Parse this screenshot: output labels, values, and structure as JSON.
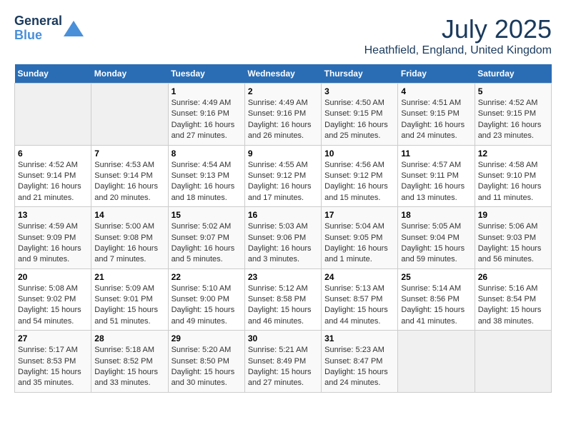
{
  "header": {
    "logo_line1": "General",
    "logo_line2": "Blue",
    "title": "July 2025",
    "subtitle": "Heathfield, England, United Kingdom"
  },
  "columns": [
    "Sunday",
    "Monday",
    "Tuesday",
    "Wednesday",
    "Thursday",
    "Friday",
    "Saturday"
  ],
  "weeks": [
    [
      {
        "day": "",
        "info": ""
      },
      {
        "day": "",
        "info": ""
      },
      {
        "day": "1",
        "info": "Sunrise: 4:49 AM\nSunset: 9:16 PM\nDaylight: 16 hours\nand 27 minutes."
      },
      {
        "day": "2",
        "info": "Sunrise: 4:49 AM\nSunset: 9:16 PM\nDaylight: 16 hours\nand 26 minutes."
      },
      {
        "day": "3",
        "info": "Sunrise: 4:50 AM\nSunset: 9:15 PM\nDaylight: 16 hours\nand 25 minutes."
      },
      {
        "day": "4",
        "info": "Sunrise: 4:51 AM\nSunset: 9:15 PM\nDaylight: 16 hours\nand 24 minutes."
      },
      {
        "day": "5",
        "info": "Sunrise: 4:52 AM\nSunset: 9:15 PM\nDaylight: 16 hours\nand 23 minutes."
      }
    ],
    [
      {
        "day": "6",
        "info": "Sunrise: 4:52 AM\nSunset: 9:14 PM\nDaylight: 16 hours\nand 21 minutes."
      },
      {
        "day": "7",
        "info": "Sunrise: 4:53 AM\nSunset: 9:14 PM\nDaylight: 16 hours\nand 20 minutes."
      },
      {
        "day": "8",
        "info": "Sunrise: 4:54 AM\nSunset: 9:13 PM\nDaylight: 16 hours\nand 18 minutes."
      },
      {
        "day": "9",
        "info": "Sunrise: 4:55 AM\nSunset: 9:12 PM\nDaylight: 16 hours\nand 17 minutes."
      },
      {
        "day": "10",
        "info": "Sunrise: 4:56 AM\nSunset: 9:12 PM\nDaylight: 16 hours\nand 15 minutes."
      },
      {
        "day": "11",
        "info": "Sunrise: 4:57 AM\nSunset: 9:11 PM\nDaylight: 16 hours\nand 13 minutes."
      },
      {
        "day": "12",
        "info": "Sunrise: 4:58 AM\nSunset: 9:10 PM\nDaylight: 16 hours\nand 11 minutes."
      }
    ],
    [
      {
        "day": "13",
        "info": "Sunrise: 4:59 AM\nSunset: 9:09 PM\nDaylight: 16 hours\nand 9 minutes."
      },
      {
        "day": "14",
        "info": "Sunrise: 5:00 AM\nSunset: 9:08 PM\nDaylight: 16 hours\nand 7 minutes."
      },
      {
        "day": "15",
        "info": "Sunrise: 5:02 AM\nSunset: 9:07 PM\nDaylight: 16 hours\nand 5 minutes."
      },
      {
        "day": "16",
        "info": "Sunrise: 5:03 AM\nSunset: 9:06 PM\nDaylight: 16 hours\nand 3 minutes."
      },
      {
        "day": "17",
        "info": "Sunrise: 5:04 AM\nSunset: 9:05 PM\nDaylight: 16 hours\nand 1 minute."
      },
      {
        "day": "18",
        "info": "Sunrise: 5:05 AM\nSunset: 9:04 PM\nDaylight: 15 hours\nand 59 minutes."
      },
      {
        "day": "19",
        "info": "Sunrise: 5:06 AM\nSunset: 9:03 PM\nDaylight: 15 hours\nand 56 minutes."
      }
    ],
    [
      {
        "day": "20",
        "info": "Sunrise: 5:08 AM\nSunset: 9:02 PM\nDaylight: 15 hours\nand 54 minutes."
      },
      {
        "day": "21",
        "info": "Sunrise: 5:09 AM\nSunset: 9:01 PM\nDaylight: 15 hours\nand 51 minutes."
      },
      {
        "day": "22",
        "info": "Sunrise: 5:10 AM\nSunset: 9:00 PM\nDaylight: 15 hours\nand 49 minutes."
      },
      {
        "day": "23",
        "info": "Sunrise: 5:12 AM\nSunset: 8:58 PM\nDaylight: 15 hours\nand 46 minutes."
      },
      {
        "day": "24",
        "info": "Sunrise: 5:13 AM\nSunset: 8:57 PM\nDaylight: 15 hours\nand 44 minutes."
      },
      {
        "day": "25",
        "info": "Sunrise: 5:14 AM\nSunset: 8:56 PM\nDaylight: 15 hours\nand 41 minutes."
      },
      {
        "day": "26",
        "info": "Sunrise: 5:16 AM\nSunset: 8:54 PM\nDaylight: 15 hours\nand 38 minutes."
      }
    ],
    [
      {
        "day": "27",
        "info": "Sunrise: 5:17 AM\nSunset: 8:53 PM\nDaylight: 15 hours\nand 35 minutes."
      },
      {
        "day": "28",
        "info": "Sunrise: 5:18 AM\nSunset: 8:52 PM\nDaylight: 15 hours\nand 33 minutes."
      },
      {
        "day": "29",
        "info": "Sunrise: 5:20 AM\nSunset: 8:50 PM\nDaylight: 15 hours\nand 30 minutes."
      },
      {
        "day": "30",
        "info": "Sunrise: 5:21 AM\nSunset: 8:49 PM\nDaylight: 15 hours\nand 27 minutes."
      },
      {
        "day": "31",
        "info": "Sunrise: 5:23 AM\nSunset: 8:47 PM\nDaylight: 15 hours\nand 24 minutes."
      },
      {
        "day": "",
        "info": ""
      },
      {
        "day": "",
        "info": ""
      }
    ]
  ]
}
